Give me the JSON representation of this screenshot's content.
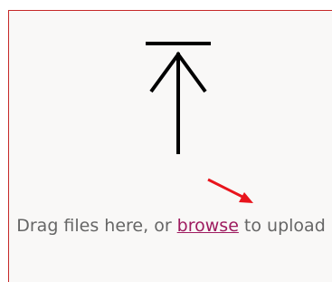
{
  "dropzone": {
    "text_before": "Drag files here, or ",
    "browse_label": "browse",
    "text_after": " to upload",
    "icon": "upload-arrow-icon",
    "annotation_icon": "red-arrow-annotation",
    "colors": {
      "link": "#9e1b5f",
      "text": "#666666",
      "border": "#c62828",
      "annotation": "#e8141c"
    }
  }
}
